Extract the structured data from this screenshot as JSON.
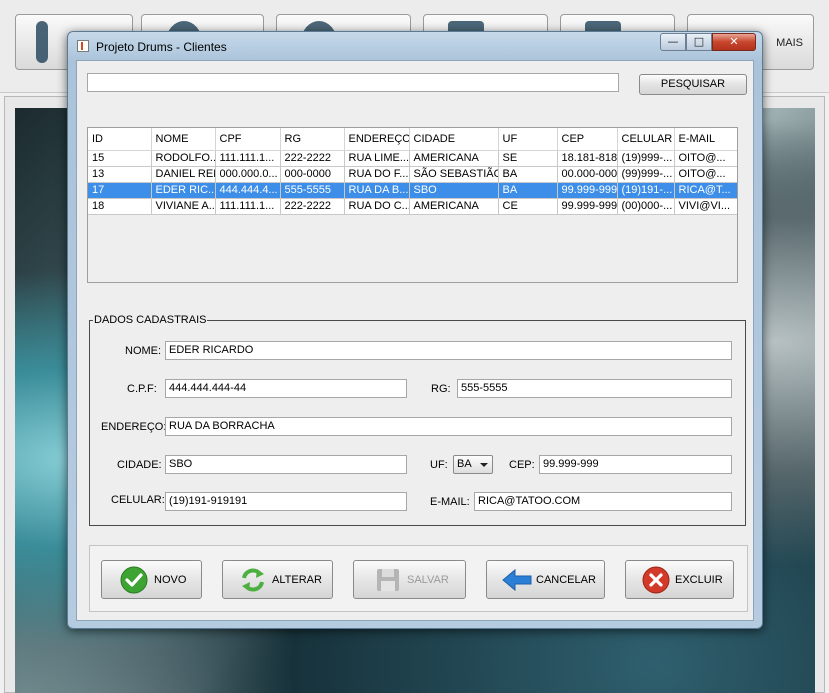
{
  "background": {
    "toolbar_visible_label": "MAIS"
  },
  "window": {
    "title": "Projeto Drums - Clientes",
    "caption": {
      "minimize": "—",
      "maximize": "□",
      "close": "✕"
    }
  },
  "search": {
    "value": "",
    "button": "PESQUISAR"
  },
  "table": {
    "columns": [
      "ID",
      "NOME",
      "CPF",
      "RG",
      "ENDEREÇO",
      "CIDADE",
      "UF",
      "CEP",
      "CELULAR",
      "E-MAIL"
    ],
    "rows": [
      [
        "15",
        "RODOLFO...",
        "111.111.1...",
        "222-2222",
        "RUA LIME...",
        "AMERICANA",
        "SE",
        "18.181-818",
        "(19)999-...",
        "OITO@..."
      ],
      [
        "13",
        "DANIEL REIS",
        "000.000.0...",
        "000-0000",
        "RUA DO F...",
        "SÃO SEBASTIÃO",
        "BA",
        "00.000-000",
        "(99)999-...",
        "OITO@..."
      ],
      [
        "17",
        "EDER RIC...",
        "444.444.4...",
        "555-5555",
        "RUA DA B...",
        "SBO",
        "BA",
        "99.999-999",
        "(19)191-...",
        "RICA@T..."
      ],
      [
        "18",
        "VIVIANE A...",
        "111.111.1...",
        "222-2222",
        "RUA DO C...",
        "AMERICANA",
        "CE",
        "99.999-999",
        "(00)000-...",
        "VIVI@VI..."
      ]
    ],
    "selected_row": 2
  },
  "form": {
    "legend": "DADOS CADASTRAIS",
    "nome_label": "NOME:",
    "nome": "EDER RICARDO",
    "cpf_label": "C.P.F:",
    "cpf": "444.444.444-44",
    "rg_label": "RG:",
    "rg": "555-5555",
    "endereco_label": "ENDEREÇO:",
    "endereco": "RUA DA BORRACHA",
    "cidade_label": "CIDADE:",
    "cidade": "SBO",
    "uf_label": "UF:",
    "uf": "BA",
    "cep_label": "CEP:",
    "cep": "99.999-999",
    "celular_label": "CELULAR:",
    "celular": "(19)191-919191",
    "email_label": "E-MAIL:",
    "email": "RICA@TATOO.COM"
  },
  "actions": {
    "novo": "NOVO",
    "alterar": "ALTERAR",
    "salvar": "SALVAR",
    "cancelar": "CANCELAR",
    "excluir": "EXCLUIR"
  },
  "colors": {
    "selection": "#3d8ee8",
    "novo_icon": "#3da332",
    "alterar_icon": "#4caf3f",
    "cancelar_icon": "#2b7fd6",
    "excluir_icon": "#d23a2a"
  },
  "icons": {
    "novo": "check-icon",
    "alterar": "refresh-icon",
    "salvar": "floppy-disk-icon",
    "cancelar": "back-arrow-icon",
    "excluir": "x-circle-icon"
  }
}
